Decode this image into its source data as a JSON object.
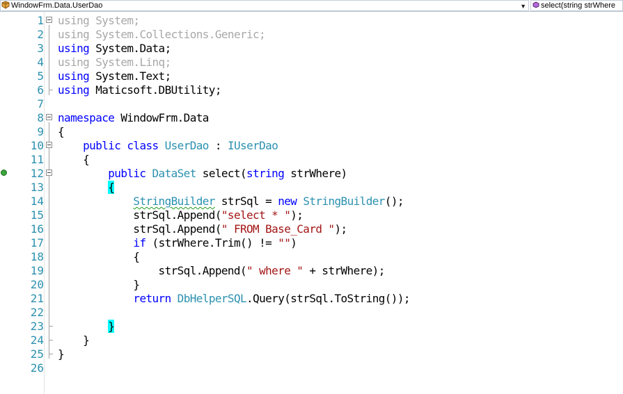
{
  "navbar": {
    "class_dropdown": "WindowFrm.Data.UserDao",
    "member_dropdown": "select(string strWhere"
  },
  "editor": {
    "line_numbers": [
      "1",
      "2",
      "3",
      "4",
      "5",
      "6",
      "7",
      "8",
      "9",
      "10",
      "11",
      "12",
      "13",
      "14",
      "15",
      "16",
      "17",
      "18",
      "19",
      "20",
      "21",
      "22",
      "23",
      "24",
      "25",
      "26"
    ],
    "lines": {
      "l1": [
        "using",
        "System;"
      ],
      "l2": [
        "using",
        "System.Collections.Generic;"
      ],
      "l3": [
        "using",
        "System.Data;"
      ],
      "l4": [
        "using",
        "System.Linq;"
      ],
      "l5": [
        "using",
        "System.Text;"
      ],
      "l6": [
        "using",
        "Maticsoft.DBUtility;"
      ],
      "l8": [
        "namespace",
        "WindowFrm.Data"
      ],
      "l9": [
        "{"
      ],
      "l10": [
        "public",
        "class",
        "UserDao",
        ":",
        "IUserDao"
      ],
      "l11": [
        "{"
      ],
      "l12": [
        "public",
        "DataSet",
        "select(",
        "string",
        "strWhere)"
      ],
      "l13": [
        "{"
      ],
      "l14": [
        "StringBuilder",
        "strSql =",
        "new",
        "StringBuilder",
        "();"
      ],
      "l15": [
        "strSql.Append(",
        "\"select * \"",
        ");"
      ],
      "l16": [
        "strSql.Append(",
        "\" FROM Base_Card \"",
        ");"
      ],
      "l17": [
        "if",
        "(strWhere.Trim() !=",
        "\"\"",
        ")"
      ],
      "l18": [
        "{"
      ],
      "l19": [
        "strSql.Append(",
        "\" where \"",
        "+ strWhere);"
      ],
      "l20": [
        "}"
      ],
      "l21": [
        "return",
        "DbHelperSQL",
        ".Query(strSql.ToString());"
      ],
      "l23": [
        "}"
      ],
      "l24": [
        "}"
      ],
      "l25": [
        "}"
      ]
    }
  },
  "colors": {
    "keyword": "#0000ff",
    "type": "#2b91af",
    "string": "#a31515",
    "unused_using": "#a8a8a8",
    "brace_highlight": "#00ffff"
  },
  "icons": {
    "class_dropdown_icon": "class-icon",
    "member_dropdown_icon": "method-icon",
    "dropdown_arrow": "chevron-down-icon",
    "line12_marker": "implements-interface-icon"
  }
}
